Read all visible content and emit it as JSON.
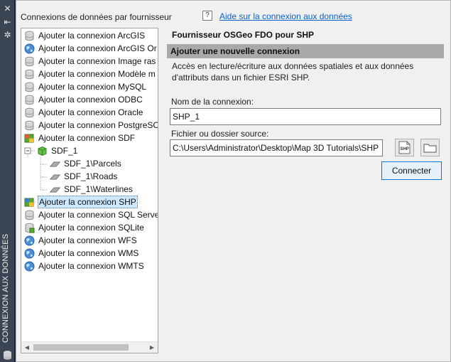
{
  "sidebar": {
    "title": "CONNEXION AUX DONNÉES"
  },
  "header": {
    "providers_label": "Connexions de données par fournisseur",
    "help_link": "Aide sur la connexion aux données"
  },
  "tree": {
    "items": [
      {
        "label": "Ajouter la connexion ArcGIS",
        "icon": "database-icon"
      },
      {
        "label": "Ajouter la connexion ArcGIS Or",
        "icon": "globe-icon"
      },
      {
        "label": "Ajouter la connexion Image ras",
        "icon": "database-icon"
      },
      {
        "label": "Ajouter la connexion Modèle m",
        "icon": "database-icon"
      },
      {
        "label": "Ajouter la connexion MySQL",
        "icon": "database-icon"
      },
      {
        "label": "Ajouter la connexion ODBC",
        "icon": "database-icon"
      },
      {
        "label": "Ajouter la connexion Oracle",
        "icon": "database-icon"
      },
      {
        "label": "Ajouter la connexion PostgreSC",
        "icon": "database-icon"
      },
      {
        "label": "Ajouter la connexion SDF",
        "icon": "sdf-icon"
      },
      {
        "label": "SDF_1",
        "icon": "cube-icon"
      },
      {
        "label": "SDF_1\\Parcels",
        "icon": "feature-class-icon"
      },
      {
        "label": "SDF_1\\Roads",
        "icon": "feature-class-icon"
      },
      {
        "label": "SDF_1\\Waterlines",
        "icon": "feature-class-icon"
      },
      {
        "label": "Ajouter la connexion SHP",
        "icon": "shp-icon",
        "selected": true
      },
      {
        "label": "Ajouter la connexion SQL Serve",
        "icon": "database-icon"
      },
      {
        "label": "Ajouter la connexion SQLite",
        "icon": "sqlite-icon"
      },
      {
        "label": "Ajouter la connexion WFS",
        "icon": "globe-icon"
      },
      {
        "label": "Ajouter la connexion WMS",
        "icon": "globe-icon"
      },
      {
        "label": "Ajouter la connexion WMTS",
        "icon": "globe-icon"
      }
    ]
  },
  "detail": {
    "provider_title": "Fournisseur OSGeo FDO pour SHP",
    "section_title": "Ajouter une nouvelle connexion",
    "description": "Accès en lecture/écriture aux données spatiales et aux données d'attributs dans un fichier ESRI SHP.",
    "name_label": "Nom de la connexion:",
    "name_value": "SHP_1",
    "source_label": "Fichier ou dossier source:",
    "source_value": "C:\\Users\\Administrator\\Desktop\\Map 3D Tutorials\\SHP",
    "shp_button_text": "SHP",
    "connect_label": "Connecter"
  },
  "colors": {
    "accent": "#0078d7",
    "link": "#0a5fc8",
    "selection": "#cce8ff",
    "section_band": "#a9a9a9",
    "strip": "#3b4453"
  }
}
